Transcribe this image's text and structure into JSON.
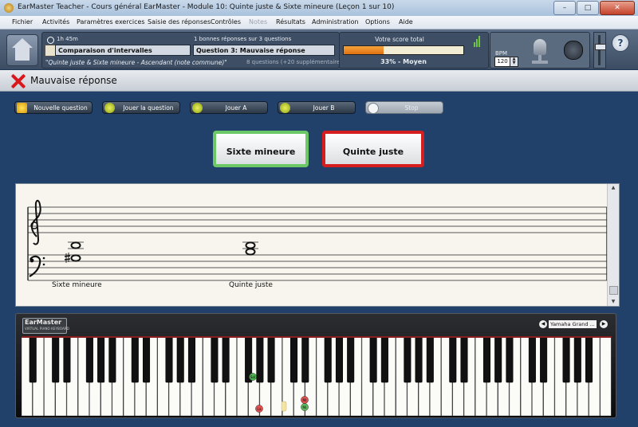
{
  "window": {
    "title": "EarMaster Teacher - Cours général EarMaster - Module 10: Quinte juste & Sixte mineure (Leçon 1 sur 10)",
    "minimize": "–",
    "maximize": "□",
    "close": "✕"
  },
  "menu": {
    "items": [
      {
        "label": "Fichier",
        "enabled": true
      },
      {
        "label": "Activités",
        "enabled": true
      },
      {
        "label": "Paramètres exercices",
        "enabled": true
      },
      {
        "label": "Saisie des réponses",
        "enabled": true
      },
      {
        "label": "Contrôles",
        "enabled": true
      },
      {
        "label": "Notes",
        "enabled": false
      },
      {
        "label": "Résultats",
        "enabled": true
      },
      {
        "label": "Administration",
        "enabled": true
      },
      {
        "label": "Options",
        "enabled": true
      },
      {
        "label": "Aide",
        "enabled": true
      }
    ]
  },
  "header": {
    "time": "1h 45m",
    "answers_count": "1 bonnes réponses sur 3 questions",
    "exercise": "Comparaison d'intervalles",
    "question": "Question 3: Mauvaise réponse",
    "exercise_detail": "\"Quinte juste & Sixte mineure - Ascendant (note commune)\"",
    "questions_total": "8 questions (+20 supplémentaires)",
    "score_label": "Votre score total",
    "score_percent": 33,
    "score_text": "33% - Moyen",
    "bpm_label": "BPM",
    "bpm_value": "120",
    "help": "?"
  },
  "status": {
    "text": "Mauvaise réponse"
  },
  "toolbar": {
    "new_question": "Nouvelle question",
    "play_question": "Jouer la question",
    "play_a": "Jouer A",
    "play_b": "Jouer B",
    "stop": "Stop"
  },
  "answers": {
    "correct": "Sixte mineure",
    "wrong": "Quinte juste"
  },
  "staff": {
    "label_a": "Sixte mineure",
    "label_b": "Quinte juste"
  },
  "piano": {
    "brand": "EarMaster",
    "brand_sub": "VIRTUAL PIANO KEYBOARD",
    "instrument": "Yamaha Grand ...",
    "markers": [
      "Sol",
      "La",
      "Mi",
      "Mi"
    ]
  },
  "colors": {
    "correct_border": "#6cc865",
    "wrong_border": "#d71e1e",
    "score_fill": "#f08a20"
  }
}
